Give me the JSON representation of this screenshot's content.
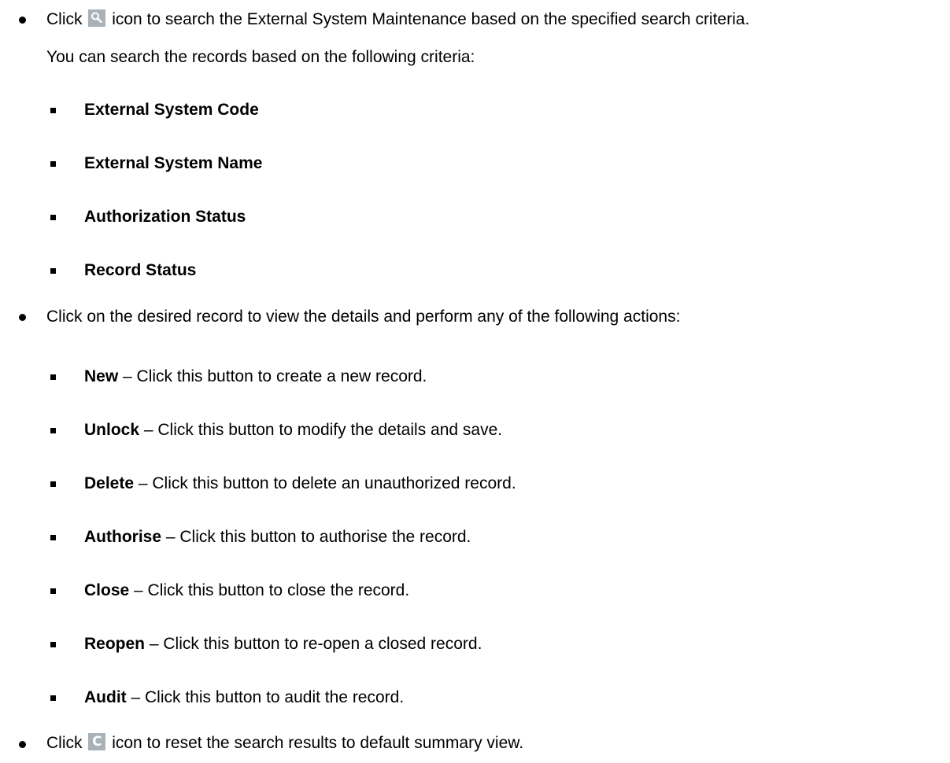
{
  "search_bullet": {
    "prefix": "Click",
    "suffix": "icon to search the External System Maintenance based on the specified search criteria.",
    "line2": "You can search the records based on the following criteria:",
    "icon": "search-icon"
  },
  "criteria": [
    "External System Code",
    "External System Name",
    "Authorization Status",
    "Record Status"
  ],
  "actions_bullet": {
    "text": "Click on the desired record to view the details and perform any of the following actions:"
  },
  "actions": [
    {
      "name": "New",
      "desc": " – Click this button to create a new record."
    },
    {
      "name": "Unlock",
      "desc": " – Click this button to modify the details and save."
    },
    {
      "name": "Delete",
      "desc": " – Click this button to delete an unauthorized record."
    },
    {
      "name": "Authorise",
      "desc": " – Click this button to authorise the record."
    },
    {
      "name": "Close",
      "desc": " – Click this button to close the record."
    },
    {
      "name": "Reopen",
      "desc": " – Click this button to re-open a closed record."
    },
    {
      "name": "Audit",
      "desc": " – Click this button to audit the record."
    }
  ],
  "reset_bullet": {
    "prefix": "Click",
    "suffix": "icon to reset the search results to default summary view.",
    "icon": "reset-icon",
    "icon_glyph": "C"
  },
  "colors": {
    "icon_background": "#a9b2b9",
    "text": "#000000"
  }
}
